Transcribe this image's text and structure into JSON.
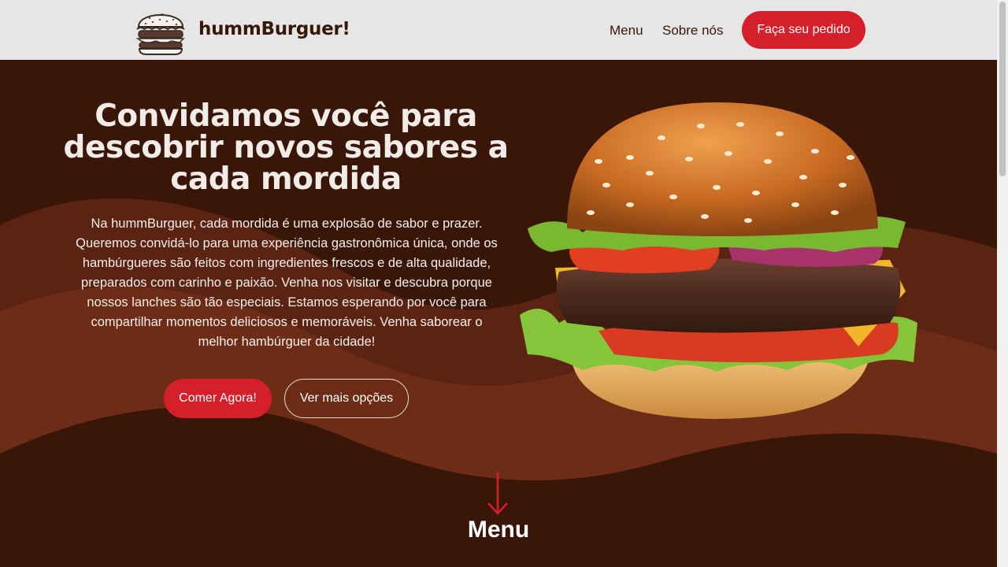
{
  "header": {
    "brand": "hummBurguer!",
    "nav": [
      {
        "label": "Menu"
      },
      {
        "label": "Sobre nós"
      }
    ],
    "order_button": "Faça seu pedido"
  },
  "hero": {
    "headline": "Convidamos você para descobrir novos sabores a cada mordida",
    "intro": "Na hummBurguer, cada mordida é uma explosão de sabor e prazer. Queremos convidá-lo para uma experiência gastronômica única, onde os hambúrgueres são feitos com ingredientes frescos e de alta qualidade, preparados com carinho e paixão. Venha nos visitar e descubra porque nossos lanches são tão especiais. Estamos esperando por você para compartilhar momentos deliciosos e memoráveis. Venha saborear o melhor hambúrguer da cidade!",
    "primary_button": "Comer Agora!",
    "secondary_button": "Ver mais opções"
  },
  "menu_section": {
    "title": "Menu"
  },
  "icons": {
    "logo": "burger-logo-icon",
    "scroll_arrow": "arrow-down-icon"
  },
  "colors": {
    "header_bg": "#e6e6e6",
    "hero_bg": "#3a1609",
    "accent_red": "#d51f2b",
    "brand_text": "#3a1609"
  }
}
